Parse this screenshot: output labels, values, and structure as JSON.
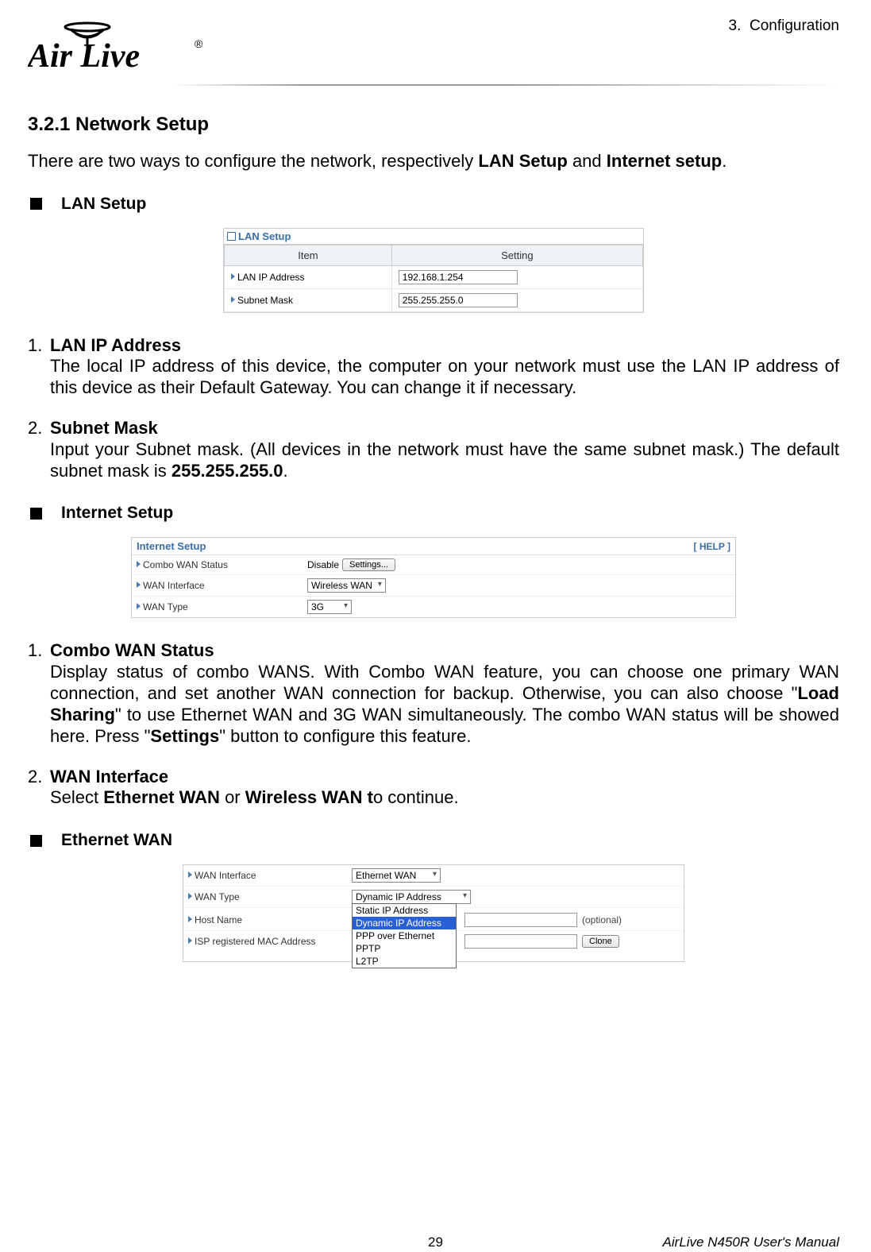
{
  "header": {
    "breadcrumb_prefix": "3.",
    "breadcrumb": "Configuration",
    "logo_text": "Air Live",
    "logo_reg": "®"
  },
  "section": {
    "heading": "3.2.1 Network Setup",
    "intro_pre": "There are two ways to configure the network, respectively ",
    "intro_b1": "LAN Setup",
    "intro_mid": " and ",
    "intro_b2": "Internet setup",
    "intro_post": "."
  },
  "lan": {
    "bullet": "LAN Setup",
    "panel_title": "LAN Setup",
    "col_item": "Item",
    "col_setting": "Setting",
    "rows": [
      {
        "label": "LAN IP Address",
        "value": "192.168.1.254"
      },
      {
        "label": "Subnet Mask",
        "value": "255.255.255.0"
      }
    ],
    "items": [
      {
        "title": "LAN IP Address",
        "text": "The local IP address of this device, the computer on your network must use the LAN IP address of this device as their Default Gateway. You can change it if necessary."
      },
      {
        "title": "Subnet Mask",
        "text_pre": "Input your Subnet mask. (All devices in the network must have the same subnet mask.) The default subnet mask is ",
        "text_b": "255.255.255.0",
        "text_post": "."
      }
    ]
  },
  "inet": {
    "bullet": "Internet Setup",
    "panel_title": "Internet Setup",
    "help": "[ HELP ]",
    "rows": {
      "combo": {
        "label": "Combo WAN Status",
        "value": "Disable",
        "button": "Settings..."
      },
      "wan_iface": {
        "label": "WAN Interface",
        "value": "Wireless WAN"
      },
      "wan_type": {
        "label": "WAN Type",
        "value": "3G"
      }
    },
    "items": [
      {
        "title": "Combo WAN Status",
        "text_pre": "Display status of combo WANS. With Combo WAN feature, you can choose one primary WAN connection, and set another WAN connection for backup. Otherwise, you can also choose \"",
        "text_b1": "Load Sharing",
        "text_mid": "\" to use Ethernet WAN and 3G WAN simultaneously. The combo WAN status will be showed here. Press \"",
        "text_b2": "Settings",
        "text_post": "\" button to configure this feature."
      },
      {
        "title": "WAN Interface",
        "text_pre": "Select ",
        "text_b1": "Ethernet WAN",
        "text_mid": " or ",
        "text_b2": "Wireless WAN t",
        "text_post": "o continue."
      }
    ]
  },
  "eth": {
    "bullet": "Ethernet WAN",
    "rows": {
      "wan_iface": {
        "label": "WAN Interface",
        "value": "Ethernet WAN"
      },
      "wan_type": {
        "label": "WAN Type",
        "value": "Dynamic IP Address",
        "options": [
          "Static IP Address",
          "Dynamic IP Address",
          "PPP over Ethernet",
          "PPTP",
          "L2TP"
        ],
        "selected_index": 1
      },
      "host": {
        "label": "Host Name",
        "note": "(optional)"
      },
      "isp_mac": {
        "label": "ISP registered MAC Address",
        "button": "Clone"
      }
    }
  },
  "footer": {
    "page": "29",
    "manual": "AirLive N450R User's Manual"
  }
}
